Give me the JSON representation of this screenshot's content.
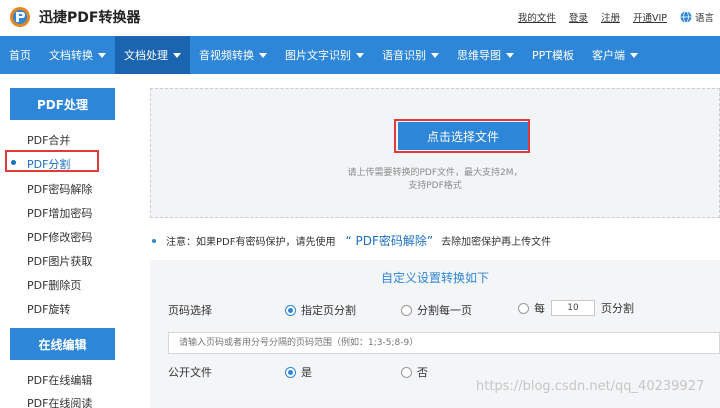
{
  "header": {
    "app_title": "迅捷PDF转换器",
    "links": [
      "我的文件",
      "登录",
      "注册",
      "开通VIP"
    ],
    "language": "语言",
    "colors": {
      "brand": "#2e86d8",
      "vip": "#e8861c"
    }
  },
  "nav": {
    "items": [
      {
        "label": "首页",
        "dropdown": false
      },
      {
        "label": "文档转换",
        "dropdown": true
      },
      {
        "label": "文档处理",
        "dropdown": true,
        "active": true
      },
      {
        "label": "音视频转换",
        "dropdown": true
      },
      {
        "label": "图片文字识别",
        "dropdown": true
      },
      {
        "label": "语音识别",
        "dropdown": true
      },
      {
        "label": "思维导图",
        "dropdown": true
      },
      {
        "label": "PPT模板",
        "dropdown": false
      },
      {
        "label": "客户端",
        "dropdown": true
      }
    ]
  },
  "sidebar": {
    "section1_title": "PDF处理",
    "section1_items": [
      "PDF合并",
      "PDF分割",
      "PDF密码解除",
      "PDF增加密码",
      "PDF修改密码",
      "PDF图片获取",
      "PDF删除页",
      "PDF旋转"
    ],
    "active_item": "PDF分割",
    "section2_title": "在线编辑",
    "section2_items": [
      "PDF在线编辑",
      "PDF在线阅读"
    ]
  },
  "upload": {
    "button_label": "点击选择文件",
    "tip_line1": "请上传需要转换的PDF文件，最大支持2M，",
    "tip_line2": "支持PDF格式"
  },
  "notice": {
    "prefix": "注意：如果PDF有密码保护，请先使用",
    "link": "“ PDF密码解除”",
    "suffix": "去除加密保护再上传文件"
  },
  "settings": {
    "title": "自定义设置转换如下",
    "page_select_label": "页码选择",
    "split_options": {
      "specified": "指定页分割",
      "each_page": "分割每一页",
      "every_prefix": "每",
      "every_value": "10",
      "every_suffix": "页分割"
    },
    "selected_split": "指定页分割",
    "range_placeholder": "请输入页码或者用分号分隔的页码范围（例如：1;3-5;8-9）",
    "public_label": "公开文件",
    "public_yes": "是",
    "public_no": "否",
    "public_selected": "是"
  },
  "watermark": "https://blog.csdn.net/qq_40239927"
}
